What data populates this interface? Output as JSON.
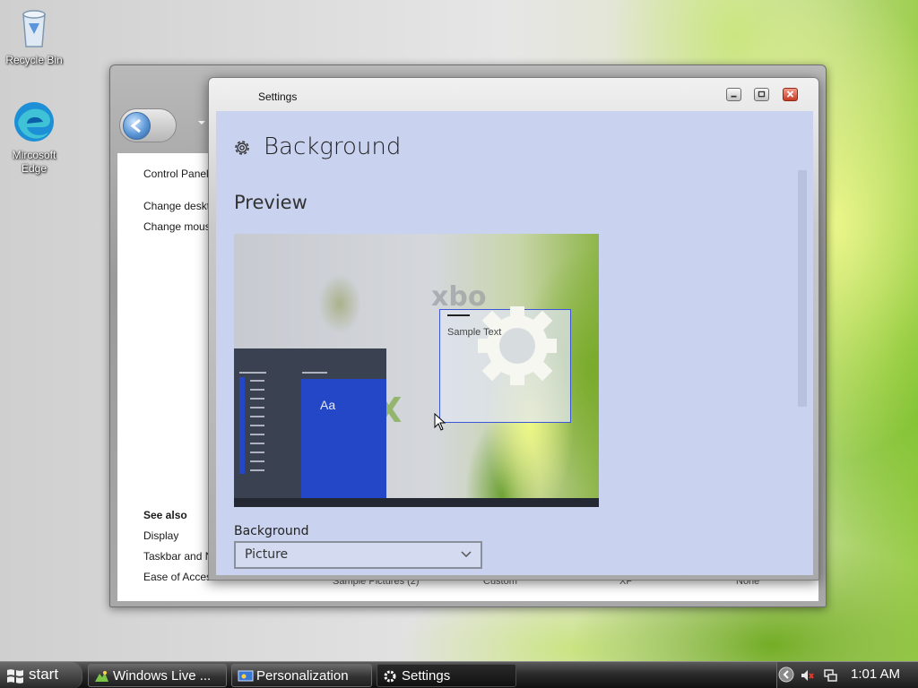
{
  "desktop": {
    "icons": [
      {
        "label": "Recycle Bin",
        "icon": "recycle-bin-icon"
      },
      {
        "label": "Mircosoft Edge",
        "icon": "edge-icon"
      }
    ]
  },
  "personalization_window": {
    "links": [
      "Control Panel",
      "Change deskt",
      "Change mous"
    ],
    "see_also_heading": "See also",
    "see_also": [
      "Display",
      "Taskbar and N",
      "Ease of Access"
    ],
    "bottom_row": [
      "Sample Pictures (2)",
      "Custom",
      "XP",
      "None"
    ]
  },
  "settings_window": {
    "title": "Settings",
    "header": "Background",
    "preview_heading": "Preview",
    "preview": {
      "tile_text": "Aa",
      "sample_text": "Sample Text"
    },
    "background_label": "Background",
    "background_value": "Picture",
    "accent_color": "#2347c6"
  },
  "taskbar": {
    "start_label": "start",
    "tasks": [
      {
        "label": "Windows Live ...",
        "icon": "windows-live-icon"
      },
      {
        "label": "Personalization",
        "icon": "personalization-icon"
      },
      {
        "label": "Settings",
        "icon": "gear-icon",
        "active": true
      }
    ],
    "clock": "1:01 AM"
  }
}
